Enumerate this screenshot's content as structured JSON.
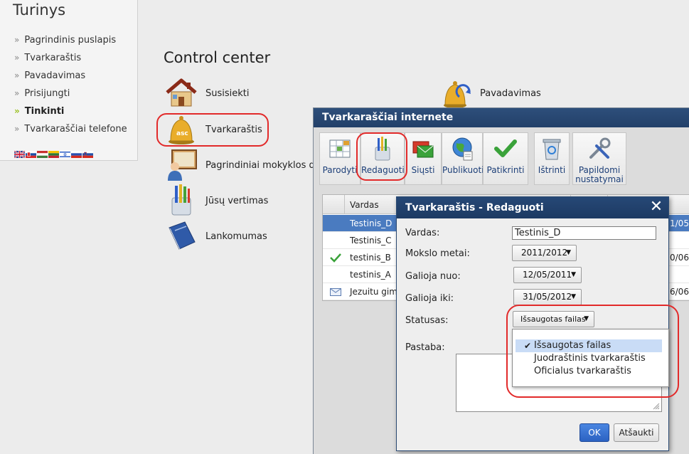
{
  "sidebar": {
    "title": "Turinys",
    "items": [
      {
        "label": "Pagrindinis puslapis",
        "active": false
      },
      {
        "label": "Tvarkaraštis",
        "active": false
      },
      {
        "label": "Pavadavimas",
        "active": false
      },
      {
        "label": "Prisijungti",
        "active": false
      },
      {
        "label": "Tinkinti",
        "active": true
      },
      {
        "label": "Tvarkaraščiai telefone",
        "active": false
      }
    ],
    "arrow": "»"
  },
  "control_center": {
    "title": "Control center",
    "items": [
      {
        "label": "Susisiekti",
        "icon": "house-icon"
      },
      {
        "label": "Tvarkaraštis",
        "icon": "bell-icon"
      },
      {
        "label": "Pagrindiniai mokyklos du",
        "icon": "teacher-icon"
      },
      {
        "label": "Jūsų vertimas",
        "icon": "pencils-icon"
      },
      {
        "label": "Lankomumas",
        "icon": "book-icon"
      },
      {
        "label": "Pavadavimas",
        "icon": "bell-arrows-icon"
      }
    ]
  },
  "window": {
    "title": "Tvarkaraščiai internete",
    "toolbar": [
      {
        "label": "Parodyti",
        "icon": "grid-icon"
      },
      {
        "label": "Redaguoti",
        "icon": "pencils-cup-icon"
      },
      {
        "label": "Siųsti",
        "icon": "envelopes-icon"
      },
      {
        "label": "Publikuoti",
        "icon": "globe-icon"
      },
      {
        "label": "Patikrinti",
        "icon": "checkmark-icon"
      },
      {
        "label": "Ištrinti",
        "icon": "recycle-bin-icon"
      },
      {
        "label": "Papildomi nustatymai",
        "icon": "tools-icon"
      }
    ],
    "grid": {
      "columns": [
        "Vardas"
      ],
      "rows": [
        {
          "name": "Testinis_D",
          "date": "1/05/",
          "selected": true,
          "status": ""
        },
        {
          "name": "Testinis_C",
          "date": "",
          "selected": false,
          "status": ""
        },
        {
          "name": "testinis_B",
          "date": "0/06/",
          "selected": false,
          "status": "check"
        },
        {
          "name": "testinis_A",
          "date": "",
          "selected": false,
          "status": ""
        },
        {
          "name": "Jezuitu gimn",
          "date": "6/06/",
          "selected": false,
          "status": "mail"
        }
      ]
    }
  },
  "dialog": {
    "title": "Tvarkaraštis - Redaguoti",
    "close_glyph": "✕",
    "fields": {
      "vardas_label": "Vardas:",
      "vardas_value": "Testinis_D",
      "mokslo_label": "Mokslo metai:",
      "mokslo_value": "2011/2012",
      "nuo_label": "Galioja nuo:",
      "nuo_value": "12/05/2011",
      "iki_label": "Galioja iki:",
      "iki_value": "31/05/2012",
      "statusas_label": "Statusas:",
      "statusas_value": "Išsaugotas failas",
      "pastaba_label": "Pastaba:"
    },
    "ok_label": "OK",
    "cancel_label": "Atšaukti",
    "caret": "▼"
  },
  "status_menu": {
    "check": "✔",
    "options": [
      {
        "label": "Išsaugotas failas",
        "selected": true
      },
      {
        "label": "Juodraštinis tvarkaraštis",
        "selected": false
      },
      {
        "label": "Oficialus tvarkaraštis",
        "selected": false
      }
    ]
  },
  "colors": {
    "highlight_circle": "#e22a2a",
    "title_bar": "#264876",
    "ok_button": "#2b62c2",
    "selected_row": "#4a7bc0"
  }
}
